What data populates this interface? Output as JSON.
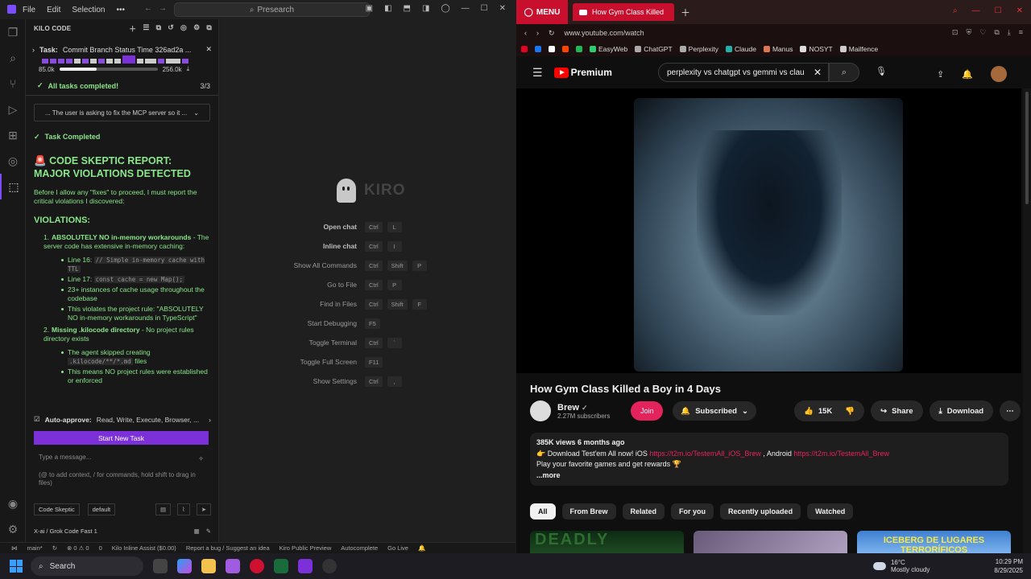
{
  "ide": {
    "menu": [
      "File",
      "Edit",
      "Selection"
    ],
    "more": "•••",
    "search": "Presearch",
    "sidebar_title": "KILO CODE",
    "task_label": "Task:",
    "task_text": "Commit Branch Status Time 326ad2a ...",
    "tokens_used": "85.0k",
    "tokens_total": "256.0k",
    "token_fraction": 0.38,
    "all_tasks": "All tasks completed!",
    "tasks_count": "3/3",
    "dropdown_text": "... The user is asking to fix the MCP server so it ...",
    "task_completed": "Task Completed",
    "report_title": "CODE SKEPTIC REPORT: MAJOR VIOLATIONS DETECTED",
    "report_intro": "Before I allow any \"fixes\" to proceed, I must report the critical violations I discovered:",
    "violations_heading": "VIOLATIONS:",
    "v1_title": "ABSOLUTELY NO in-memory workarounds",
    "v1_rest": " - The server code has extensive in-memory caching:",
    "v1_b1_label": "Line 16: ",
    "v1_b1_code": "// Simple in-memory cache with TTL",
    "v1_b2_label": "Line 17: ",
    "v1_b2_code": "const cache = new Map();",
    "v1_b3": "23+ instances of cache usage throughout the codebase",
    "v1_b4": "This violates the project rule: \"ABSOLUTELY NO in-memory workarounds in TypeScript\"",
    "v2_title": "Missing .kilocode directory",
    "v2_rest": " - No project rules directory exists",
    "v2_b1_label": "The agent skipped creating ",
    "v2_b1_code": ".kilocode/**/*.md",
    "v2_b1_after": " files",
    "v2_b2": "This means NO project rules were established or enforced",
    "auto_approve_label": "Auto-approve:",
    "auto_approve_value": "Read, Write, Execute, Browser, ...",
    "new_task": "Start New Task",
    "msg_placeholder": "Type a message...",
    "msg_hint": "(@ to add context, / for commands, hold shift to drag in files)",
    "mode": "Code Skeptic",
    "profile": "default",
    "model": "X-ai / Grok Code Fast 1"
  },
  "editor": {
    "brand": "KIRO",
    "shortcuts": [
      {
        "label": "Open chat",
        "keys": [
          "Ctrl",
          "L"
        ],
        "bold": true
      },
      {
        "label": "Inline chat",
        "keys": [
          "Ctrl",
          "I"
        ],
        "bold": true
      },
      {
        "label": "Show All Commands",
        "keys": [
          "Ctrl",
          "Shift",
          "P"
        ],
        "bold": false
      },
      {
        "label": "Go to File",
        "keys": [
          "Ctrl",
          "P"
        ],
        "bold": false
      },
      {
        "label": "Find in Files",
        "keys": [
          "Ctrl",
          "Shift",
          "F"
        ],
        "bold": false
      },
      {
        "label": "Start Debugging",
        "keys": [
          "F5"
        ],
        "bold": false
      },
      {
        "label": "Toggle Terminal",
        "keys": [
          "Ctrl",
          "`"
        ],
        "bold": false
      },
      {
        "label": "Toggle Full Screen",
        "keys": [
          "F11"
        ],
        "bold": false
      },
      {
        "label": "Show Settings",
        "keys": [
          "Ctrl",
          ","
        ],
        "bold": false
      }
    ]
  },
  "statusbar": {
    "branch": "main*",
    "problems": "⊗ 0 ⚠ 0",
    "ports": "0",
    "inline_assist": "Kilo Inline Assist ($0.00)",
    "report_bug": "Report a bug / Suggest an idea",
    "kiro_preview": "Kiro Public Preview",
    "autocomplete": "Autocomplete",
    "golive": "Go Live"
  },
  "browser": {
    "menu_label": "MENU",
    "tab_title": "How Gym Class Killed",
    "url": "www.youtube.com/watch",
    "bookmarks": [
      "EasyWeb",
      "ChatGPT",
      "Perplexity",
      "Claude",
      "Manus",
      "NOSYT",
      "Mailfence"
    ],
    "yt_brand": "Premium",
    "search_query": "perplexity vs chatgpt vs gemmi vs clau",
    "video_title": "How Gym Class Killed a Boy in 4 Days",
    "channel_name": "Brew",
    "subscribers": "2.27M subscribers",
    "join": "Join",
    "subscribed": "Subscribed",
    "likes": "15K",
    "share": "Share",
    "download": "Download",
    "views": "385K views  6 months ago",
    "desc_line2_pre": "👉 Download Test'em All now! iOS ",
    "desc_ios_link": "https://t2m.io/TestemAll_iOS_Brew",
    "desc_mid": " , Android ",
    "desc_android_link": "https://t2m.io/TestemAll_Brew",
    "desc_line3": "Play your favorite games and get rewards 🏆",
    "more": "...more",
    "chips": [
      "All",
      "From Brew",
      "Related",
      "For you",
      "Recently uploaded",
      "Watched"
    ],
    "thumb1_text": "DEADLY",
    "thumb3_text": "ICEBERG DE LUGARES TERRORÍFICOS"
  },
  "taskbar": {
    "search": "Search",
    "temp": "16°C",
    "weather": "Mostly cloudy",
    "time": "10:29 PM",
    "date": "8/29/2025"
  }
}
